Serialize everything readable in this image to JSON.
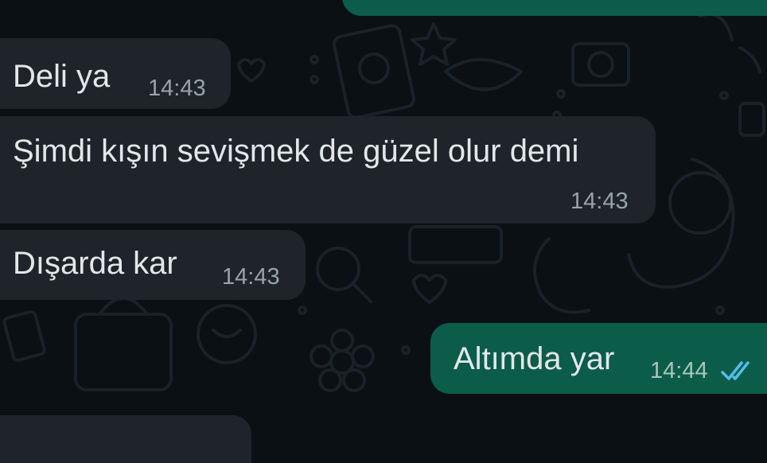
{
  "chat": {
    "messages": [
      {
        "direction": "out",
        "text": "",
        "time": ""
      },
      {
        "direction": "in",
        "text": "Deli ya",
        "time": "14:43"
      },
      {
        "direction": "in",
        "text": "Şimdi kışın sevişmek de güzel olur demi",
        "time": "14:43"
      },
      {
        "direction": "in",
        "text": "Dışarda kar",
        "time": "14:43"
      },
      {
        "direction": "out",
        "text": "Altımda yar",
        "time": "14:44",
        "status_icon": "double-check-icon"
      },
      {
        "direction": "in",
        "text": "",
        "time": ""
      }
    ]
  },
  "colors": {
    "background": "#0b1014",
    "incoming_bubble": "#1e2429",
    "outgoing_bubble": "#0c5c4a",
    "text": "#e3e7ea",
    "timestamp": "#9aa3a8",
    "read_ticks": "#53bdeb"
  }
}
